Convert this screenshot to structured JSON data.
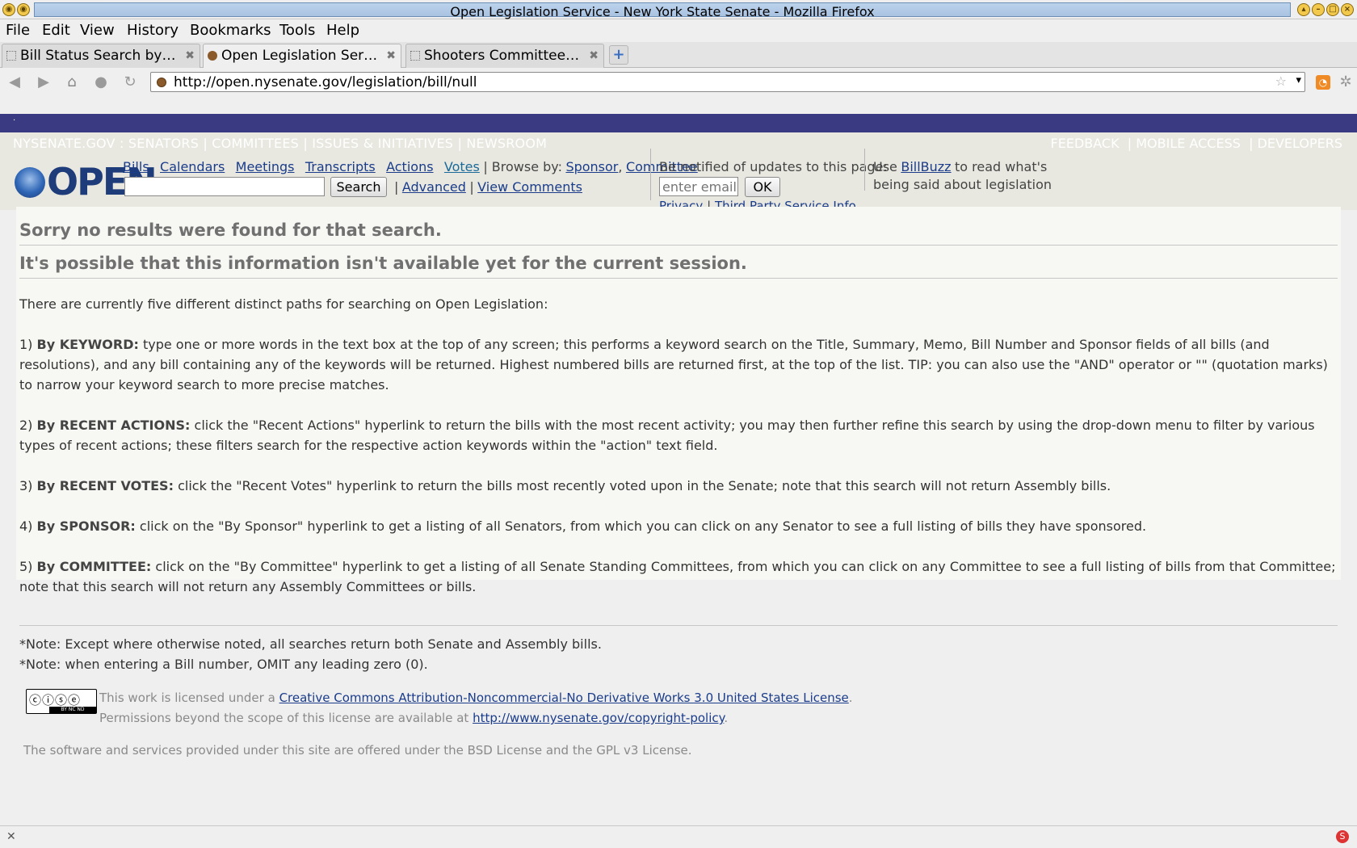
{
  "window": {
    "title": "Open Legislation Service - New York State Senate - Mozilla Firefox"
  },
  "menu": [
    "File",
    "Edit",
    "View",
    "History",
    "Bookmarks",
    "Tools",
    "Help"
  ],
  "tabs": [
    {
      "label": "Bill Status Search by…",
      "active": false
    },
    {
      "label": "Open Legislation Ser…",
      "active": true
    },
    {
      "label": "Shooters Committee…",
      "active": false
    }
  ],
  "url": "http://open.nysenate.gov/legislation/bill/null",
  "site_nav": {
    "left": [
      "NYSENATE.GOV",
      "SENATORS",
      "COMMITTEES",
      "ISSUES & INITIATIVES",
      "NEWSROOM"
    ],
    "right": [
      "FEEDBACK",
      "MOBILE ACCESS",
      "DEVELOPERS"
    ]
  },
  "logo_text": "OPEN",
  "header_links": [
    "Bills",
    "Calendars",
    "Meetings",
    "Transcripts",
    "Actions",
    "Votes"
  ],
  "browse_label": "| Browse by:",
  "browse_links": [
    "Sponsor",
    "Committee"
  ],
  "search": {
    "button": "Search",
    "advanced": "Advanced",
    "view_comments": "View Comments",
    "value": ""
  },
  "notify": {
    "label": "Be notified of updates to this page:",
    "placeholder": "enter email",
    "ok": "OK",
    "privacy": "Privacy",
    "third_party": "Third Party Service Info"
  },
  "billbuzz": {
    "pre": "Use",
    "link": "BillBuzz",
    "post": "to read what's",
    "line2": "being said about legislation"
  },
  "content": {
    "heading1": "Sorry no results were found for that search.",
    "heading2": "It's possible that this information isn't available yet for the current session.",
    "intro": "There are currently five different distinct paths for searching on Open Legislation:",
    "items": [
      {
        "num": "1)",
        "label": "By KEYWORD:",
        "text": "type one or more words in the text box at the top of any screen; this performs a keyword search on the Title, Summary, Memo, Bill Number and Sponsor fields of all bills (and resolutions), and any bill containing any of the keywords will be returned. Highest numbered bills are returned first, at the top of the list. TIP: you can also use the \"AND\" operator or \"\" (quotation marks) to narrow your keyword search to more precise matches."
      },
      {
        "num": "2)",
        "label": "By RECENT ACTIONS:",
        "text": "click the \"Recent Actions\" hyperlink to return the bills with the most recent activity; you may then further refine this search by using the drop-down menu to filter by various types of recent actions; these filters search for the respective action keywords within the \"action\" text field."
      },
      {
        "num": "3)",
        "label": "By RECENT VOTES:",
        "text": "click the \"Recent Votes\" hyperlink to return the bills most recently voted upon in the Senate; note that this search will not return Assembly bills."
      },
      {
        "num": "4)",
        "label": "By SPONSOR:",
        "text": "click on the \"By Sponsor\" hyperlink to get a listing of all Senators, from which you can click on any Senator to see a full listing of bills they have sponsored."
      },
      {
        "num": "5)",
        "label": "By COMMITTEE:",
        "text": "click on the \"By Committee\" hyperlink to get a listing of all Senate Standing Committees, from which you can click on any Committee to see a full listing of bills from that Committee; note that this search will not return any Assembly Committees or bills."
      }
    ]
  },
  "notes": [
    "*Note: Except where otherwise noted, all searches return both Senate and Assembly bills.",
    "*Note: when entering a Bill number, OMIT any leading zero (0)."
  ],
  "license": {
    "pre": "This work is licensed under a",
    "link": "Creative Commons Attribution-Noncommercial-No Derivative Works 3.0 United States License",
    "line2_pre": "Permissions beyond the scope of this license are available at",
    "line2_link": "http://www.nysenate.gov/copyright-policy",
    "badge": "BY NC ND"
  },
  "bsd": "The software and services provided under this site are offered under the BSD License and the GPL v3 License.",
  "colors": {
    "purple_bar": "#3a3a82",
    "logo_blue": "#1e3b7a",
    "link": "#1a3c8a"
  }
}
